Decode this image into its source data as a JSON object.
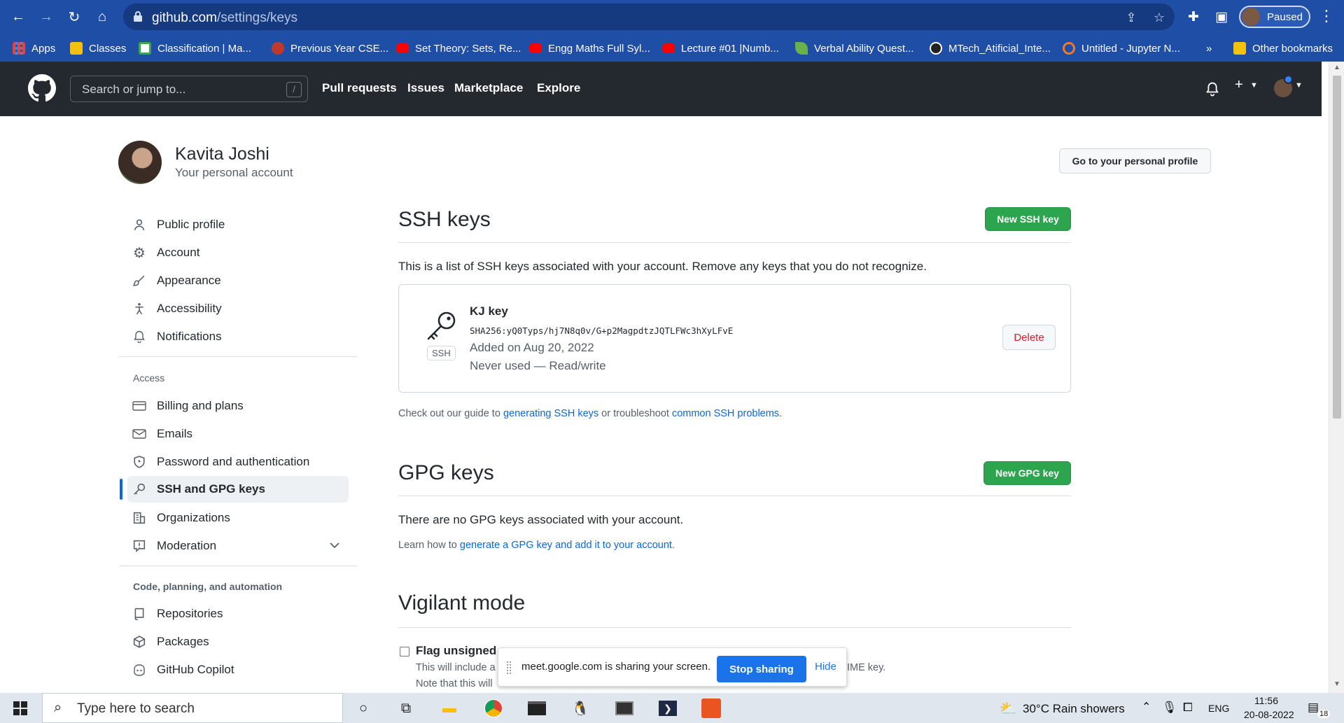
{
  "browser": {
    "url_host": "github.com",
    "url_path": "/settings/keys",
    "profile_status": "Paused",
    "bookmarks": [
      {
        "label": "Apps",
        "color": "#ffffff"
      },
      {
        "label": "Classes",
        "color": "#f4c20d"
      },
      {
        "label": "Classification | Ma...",
        "color": "#2ecc71"
      },
      {
        "label": "Previous Year CSE...",
        "color": "#e74c3c"
      },
      {
        "label": "Set Theory: Sets, Re...",
        "color": "#ff0000"
      },
      {
        "label": "Engg Maths Full Syl...",
        "color": "#ff0000"
      },
      {
        "label": "Lecture #01 |Numb...",
        "color": "#ff0000"
      },
      {
        "label": "Verbal Ability Quest...",
        "color": "#6ab04c"
      },
      {
        "label": "MTech_Atificial_Inte...",
        "color": "#222222"
      },
      {
        "label": "Untitled - Jupyter N...",
        "color": "#f37726"
      }
    ],
    "more_bookmarks": "»",
    "other_bookmarks": "Other bookmarks"
  },
  "github": {
    "search_placeholder": "Search or jump to...",
    "search_shortcut": "/",
    "nav": [
      "Pull requests",
      "Issues",
      "Marketplace",
      "Explore"
    ],
    "plus_label": "+"
  },
  "account": {
    "name": "Kavita Joshi",
    "subtitle": "Your personal account",
    "profile_button": "Go to your personal profile"
  },
  "sidebar": {
    "items_top": [
      {
        "label": "Public profile",
        "icon": "person-icon"
      },
      {
        "label": "Account",
        "icon": "gear-icon"
      },
      {
        "label": "Appearance",
        "icon": "paintbrush-icon"
      },
      {
        "label": "Accessibility",
        "icon": "accessibility-icon"
      },
      {
        "label": "Notifications",
        "icon": "bell-icon"
      }
    ],
    "access_heading": "Access",
    "items_access": [
      {
        "label": "Billing and plans",
        "icon": "credit-card-icon"
      },
      {
        "label": "Emails",
        "icon": "mail-icon"
      },
      {
        "label": "Password and authentication",
        "icon": "shield-icon"
      },
      {
        "label": "SSH and GPG keys",
        "icon": "key-icon"
      },
      {
        "label": "Organizations",
        "icon": "organization-icon"
      },
      {
        "label": "Moderation",
        "icon": "report-icon"
      }
    ],
    "code_heading": "Code, planning, and automation",
    "items_code": [
      {
        "label": "Repositories",
        "icon": "repo-icon"
      },
      {
        "label": "Packages",
        "icon": "package-icon"
      },
      {
        "label": "GitHub Copilot",
        "icon": "copilot-icon"
      }
    ]
  },
  "ssh": {
    "title": "SSH keys",
    "new_button": "New SSH key",
    "intro": "This is a list of SSH keys associated with your account. Remove any keys that you do not recognize.",
    "key": {
      "badge": "SSH",
      "title": "KJ key",
      "fingerprint": "SHA256:yQ0Typs/hj7N8q0v/G+p2MagpdtzJQTLFWc3hXyLFvE",
      "added": "Added on Aug 20, 2022",
      "usage": "Never used — Read/write",
      "delete": "Delete"
    },
    "guide_prefix": "Check out our guide to ",
    "guide_link1": "generating SSH keys",
    "guide_middle": " or troubleshoot ",
    "guide_link2": "common SSH problems",
    "guide_suffix": "."
  },
  "gpg": {
    "title": "GPG keys",
    "new_button": "New GPG key",
    "empty": "There are no GPG keys associated with your account.",
    "learn_prefix": "Learn how to ",
    "learn_link": "generate a GPG key and add it to your account",
    "learn_suffix": "."
  },
  "vigilant": {
    "title": "Vigilant mode",
    "flag_label_visible": "Flag unsigned",
    "desc1_visible": "This will include a",
    "desc1_tail": "IME key.",
    "desc2_visible": "Note that this will"
  },
  "share_bar": {
    "message": "meet.google.com is sharing your screen.",
    "stop": "Stop sharing",
    "hide": "Hide"
  },
  "taskbar": {
    "search_placeholder": "Type here to search",
    "weather": "30°C  Rain showers",
    "language": "ENG",
    "time": "11:56",
    "date": "20-08-2022",
    "notifications": "18"
  }
}
